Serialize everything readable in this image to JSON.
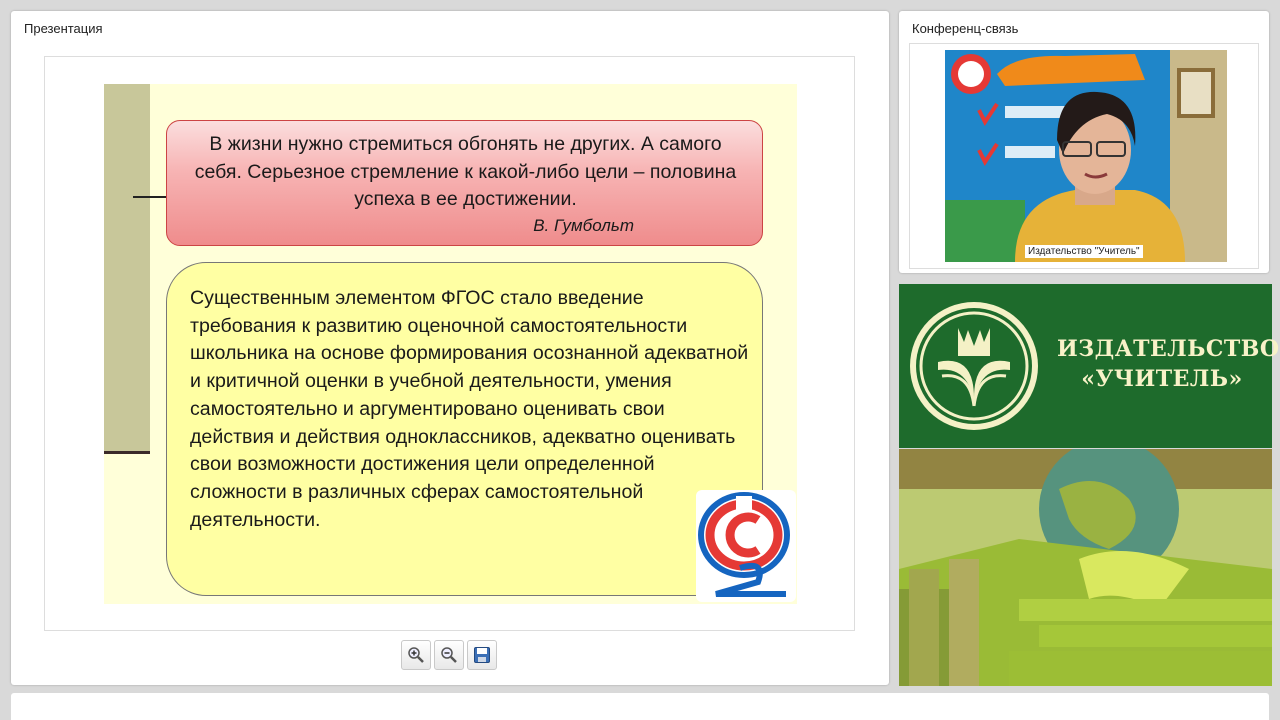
{
  "presentation": {
    "title": "Презентация",
    "slide": {
      "quote": "В жизни нужно стремиться обгонять не других. А самого себя. Серьезное стремление к какой-либо цели – половина успеха в ее достижении.",
      "author": "В. Гумбольт",
      "body": "Существенным элементом ФГОС стало введение требования к развитию оценочной самостоятельности школьника на основе формирования осознанной адекватной и критичной оценки в учебной деятельности, умения самостоятельно и аргументировано оценивать свои действия и действия одноклассников, адекватно оценивать свои возможности достижения цели определенной сложности в различных сферах самостоятельной деятельности.",
      "logo_icon": "fgos-logo"
    },
    "toolbar": {
      "zoom_in_icon": "zoom-in-icon",
      "zoom_out_icon": "zoom-out-icon",
      "save_icon": "save-icon"
    }
  },
  "conference": {
    "title": "Конференц-связь",
    "video_label": "Издательство \"Учитель\""
  },
  "publisher": {
    "name_line1": "ИЗДАТЕЛЬСТВО",
    "name_line2": "«УЧИТЕЛЬ»",
    "logo_icon": "publisher-logo"
  },
  "colors": {
    "quote_box": "#f7b4b4",
    "main_box": "#ffffa3",
    "banner": "#1e6b2c"
  }
}
